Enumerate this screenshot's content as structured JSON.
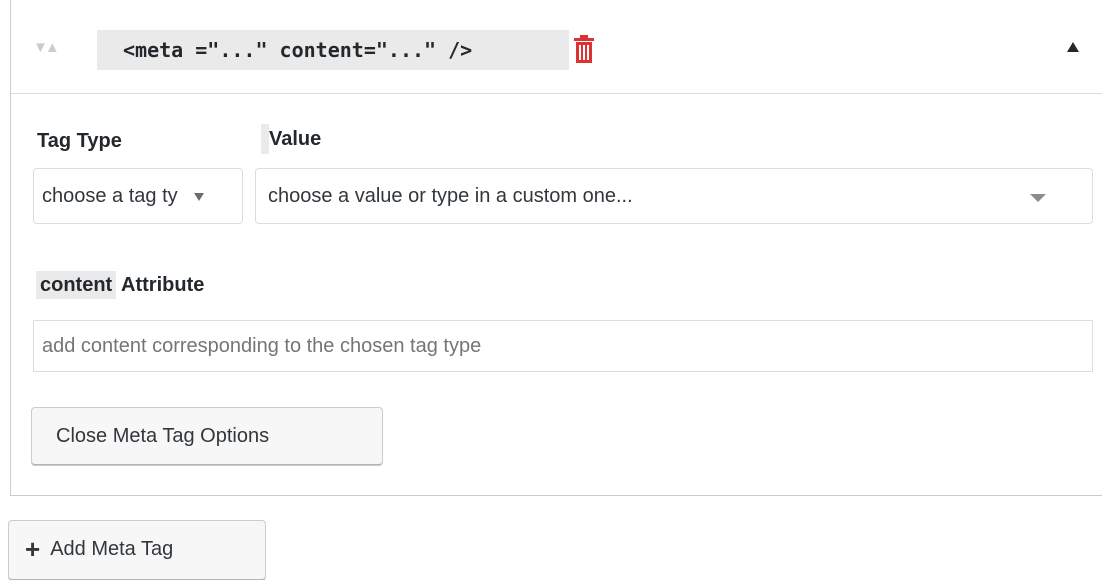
{
  "meta_tag_item": {
    "code_preview": "<meta =\"...\" content=\"...\" />",
    "tag_type": {
      "label": "Tag Type",
      "value": "choose a tag ty"
    },
    "value_field": {
      "label": "Value",
      "placeholder": "choose a value or type in a custom one..."
    },
    "content_attribute": {
      "label_code": "content",
      "label_text": " Attribute",
      "placeholder": "add content corresponding to the chosen tag type"
    },
    "close_button_label": "Close Meta Tag Options"
  },
  "add_button": {
    "icon": "plus-icon",
    "label": "Add Meta Tag"
  },
  "icons": {
    "sort": "sort-arrows-icon",
    "delete": "trash-icon",
    "collapse": "caret-up-icon"
  },
  "colors": {
    "trash": "#dc3232",
    "chip_background": "#eaeaea",
    "border": "#dddddd"
  }
}
